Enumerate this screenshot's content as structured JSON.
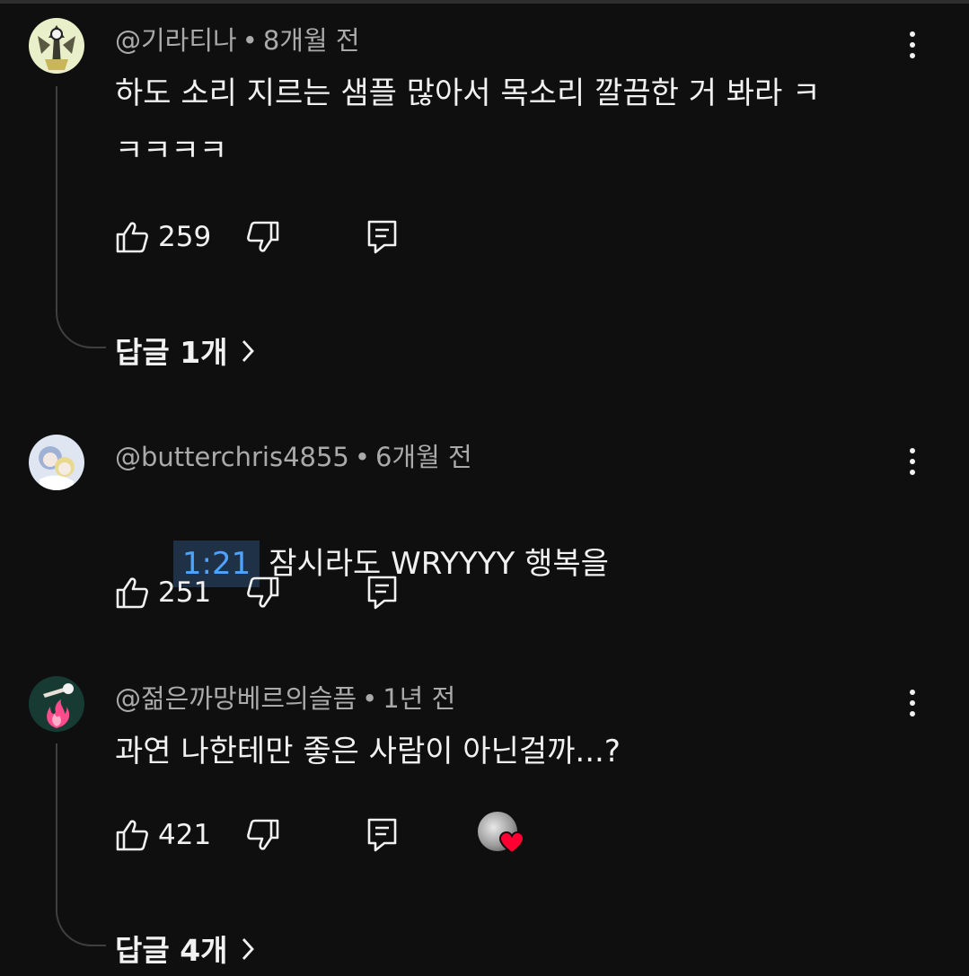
{
  "comments": [
    {
      "author": "@기라티나",
      "time": "8개월 전",
      "text": "하도 소리 지르는 샘플 많아서 목소리 깔끔한 거 봐라 ㅋ\nㅋㅋㅋㅋ",
      "likes": "259",
      "replies": "답글 1개"
    },
    {
      "author": "@butterchris4855",
      "time": "6개월 전",
      "timestamp": "1:21",
      "text": "잠시라도 WRYYYY 행복을",
      "likes": "251"
    },
    {
      "author": "@젊은까망베르의슬픔",
      "time": "1년 전",
      "text": "과연 나한테만 좋은 사람이 아닌걸까...?",
      "likes": "421",
      "replies": "답글 4개",
      "creator_heart": true
    }
  ],
  "separator": "•",
  "colors": {
    "background": "#0f0f0f",
    "text": "#f1f1f1",
    "meta": "#aaaaaa",
    "timestamp_link": "#4fa3ff",
    "heart": "#ff0033",
    "thread_line": "#3f3f3f"
  },
  "icons": [
    "like-icon",
    "dislike-icon",
    "reply-icon",
    "more-vert-icon",
    "chevron-right-icon",
    "heart-icon"
  ]
}
